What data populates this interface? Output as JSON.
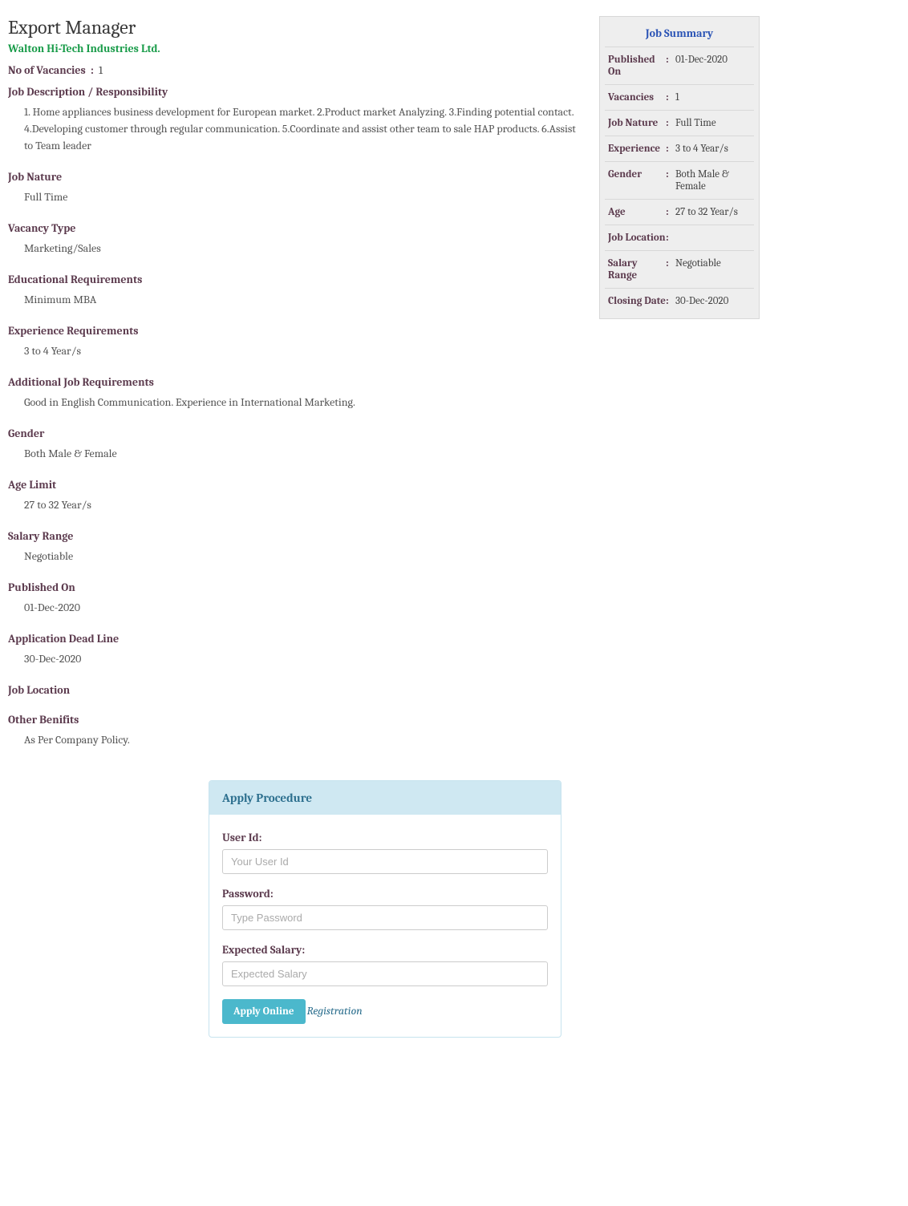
{
  "job": {
    "title": "Export Manager",
    "company": "Walton Hi-Tech Industries Ltd.",
    "vacancies_label": "No of Vacancies",
    "vacancies_value": "1",
    "sections": {
      "description_h": "Job Description / Responsibility",
      "description_v": "1. Home appliances business development for European market. 2.Product market Analyzing. 3.Finding potential contact. 4.Developing customer through regular communication. 5.Coordinate and assist other team to sale HAP products. 6.Assist to Team leader",
      "nature_h": "Job Nature",
      "nature_v": "Full Time",
      "vtype_h": "Vacancy Type",
      "vtype_v": "Marketing/Sales",
      "edu_h": "Educational Requirements",
      "edu_v": "Minimum  MBA",
      "exp_h": "Experience Requirements",
      "exp_v": "3 to 4   Year/s",
      "addl_h": "Additional Job Requirements",
      "addl_v": "Good in English Communication. Experience in International Marketing.",
      "gender_h": "Gender",
      "gender_v": "Both Male & Female",
      "age_h": "Age Limit",
      "age_v": "27 to 32   Year/s",
      "salary_h": "Salary Range",
      "salary_v": "Negotiable",
      "pub_h": "Published On",
      "pub_v": "01-Dec-2020",
      "dead_h": "Application Dead Line",
      "dead_v": "30-Dec-2020",
      "loc_h": "Job Location",
      "loc_v": "",
      "ben_h": "Other Benifits",
      "ben_v": "As Per Company Policy."
    }
  },
  "summary": {
    "title": "Job Summary",
    "rows": {
      "published_l": "Published On",
      "published_v": "01-Dec-2020",
      "vacancies_l": "Vacancies",
      "vacancies_v": "1",
      "nature_l": "Job Nature",
      "nature_v": "Full Time",
      "exp_l": "Experience",
      "exp_v": "3 to 4   Year/s",
      "gender_l": "Gender",
      "gender_v": "Both Male & Female",
      "age_l": "Age",
      "age_v": "27 to 32   Year/s",
      "loc_l": "Job Location",
      "loc_v": "",
      "salary_l": "Salary Range",
      "salary_v": "Negotiable",
      "closing_l": "Closing Date",
      "closing_v": "30-Dec-2020"
    }
  },
  "apply": {
    "header": "Apply Procedure",
    "user_label": "User Id:",
    "user_ph": "Your User Id",
    "pass_label": "Password:",
    "pass_ph": "Type Password",
    "salary_label": "Expected Salary:",
    "salary_ph": "Expected Salary",
    "button": "Apply Online",
    "reg_link": "Registration"
  }
}
